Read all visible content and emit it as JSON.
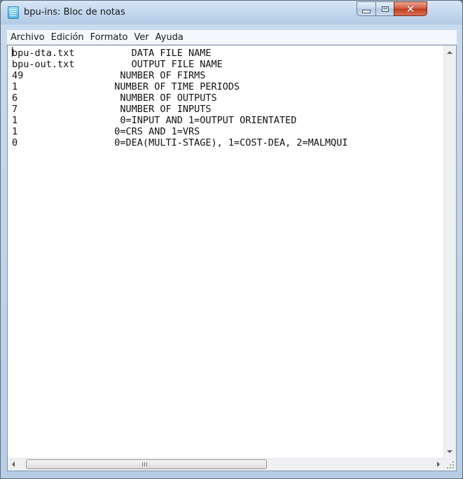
{
  "window": {
    "title": "bpu-ins: Bloc de notas"
  },
  "menu": {
    "items": [
      "Archivo",
      "Edición",
      "Formato",
      "Ver",
      "Ayuda"
    ]
  },
  "editor": {
    "lines": [
      "bpu-dta.txt          DATA FILE NAME",
      "bpu-out.txt          OUTPUT FILE NAME",
      "49                 NUMBER OF FIRMS",
      "1                 NUMBER OF TIME PERIODS",
      "6                  NUMBER OF OUTPUTS",
      "7                  NUMBER OF INPUTS",
      "1                  0=INPUT AND 1=OUTPUT ORIENTATED",
      "1                 0=CRS AND 1=VRS",
      "0                 0=DEA(MULTI-STAGE), 1=COST-DEA, 2=MALMQUI"
    ]
  },
  "colors": {
    "close_button": "#c13a1c",
    "title_bar": "#c3d7ee",
    "editor_background": "#ffffff"
  }
}
